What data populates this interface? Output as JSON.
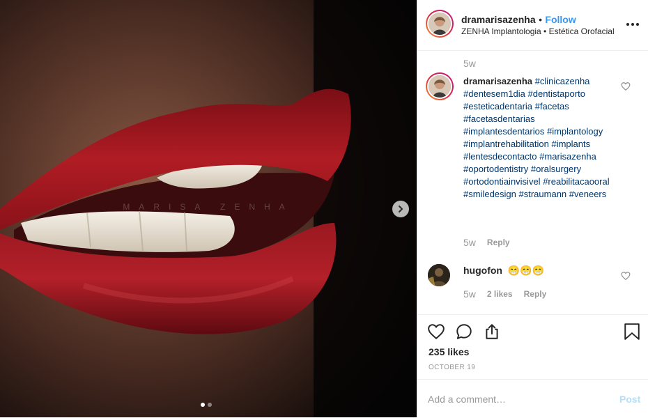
{
  "header": {
    "username": "dramarisazenha",
    "separator": "•",
    "follow_label": "Follow",
    "subtitle": "ZENHA Implantologia • Estética Orofacial",
    "more_icon": "more-horizontal-icon"
  },
  "media": {
    "watermark": "MARISA ZENHA",
    "next_icon": "chevron-right-icon",
    "carousel_count": 2,
    "carousel_active": 1
  },
  "post_time": "5w",
  "caption": {
    "username": "dramarisazenha",
    "hashtags": [
      "#clinicazenha",
      "#dentesem1dia",
      "#dentistaporto",
      "#esteticadentaria",
      "#facetas",
      "#facetasdentarias",
      "#implantesdentarios",
      "#implantology",
      "#implantrehabilitation",
      "#implants",
      "#lentesdecontacto",
      "#marisazenha",
      "#oportodentistry",
      "#oralsurgery",
      "#ortodontiainvisivel",
      "#reabilitacaooral",
      "#smiledesign",
      "#straumann",
      "#veneers"
    ],
    "time": "5w",
    "reply_label": "Reply"
  },
  "comment": {
    "username": "hugofon",
    "text": "😁😁😁",
    "time": "5w",
    "likes": "2 likes",
    "reply_label": "Reply"
  },
  "actions": {
    "likes": "235 likes",
    "date": "OCTOBER 19"
  },
  "add_comment": {
    "placeholder": "Add a comment…",
    "post_label": "Post"
  },
  "colors": {
    "accent": "#3897f0",
    "hashtag": "#003569",
    "muted": "#999999",
    "post_disabled": "#b2dffc"
  }
}
